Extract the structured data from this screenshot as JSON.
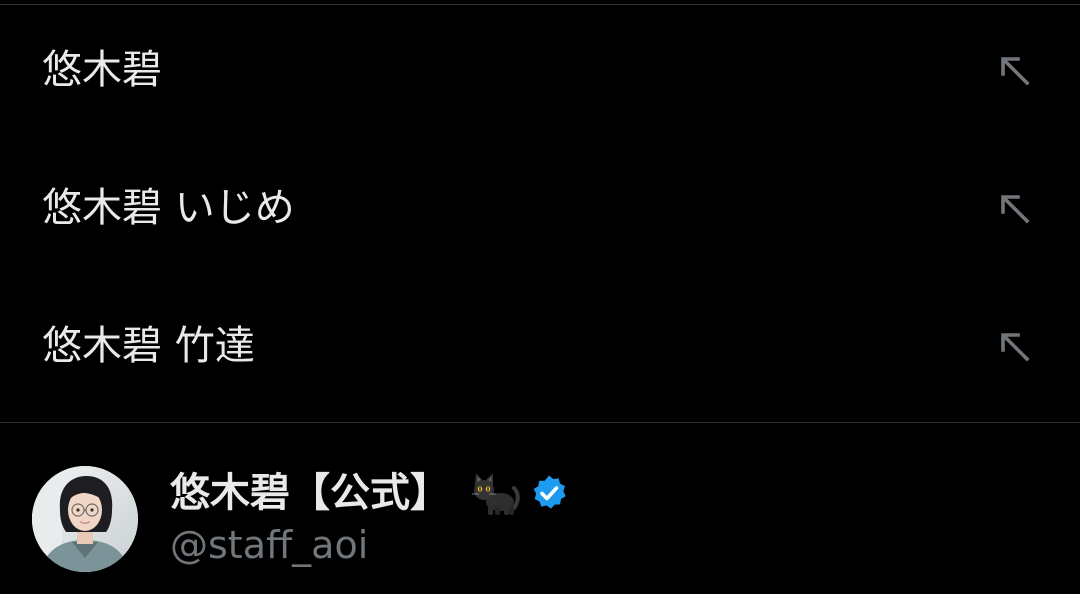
{
  "suggestions": [
    {
      "text": "悠木碧",
      "action_icon": "arrow-up-left-icon"
    },
    {
      "text": "悠木碧 いじめ",
      "action_icon": "arrow-up-left-icon"
    },
    {
      "text": "悠木碧 竹達",
      "action_icon": "arrow-up-left-icon"
    }
  ],
  "user": {
    "display_name": "悠木碧【公式】",
    "emoji": "black-cat-emoji",
    "verified": true,
    "verified_color": "#1d9bf0",
    "handle": "@staff_aoi"
  },
  "colors": {
    "background": "#000000",
    "primary_text": "#e7e9ea",
    "secondary_text": "#71767b",
    "divider": "#2f3336",
    "icon": "#71767b"
  }
}
